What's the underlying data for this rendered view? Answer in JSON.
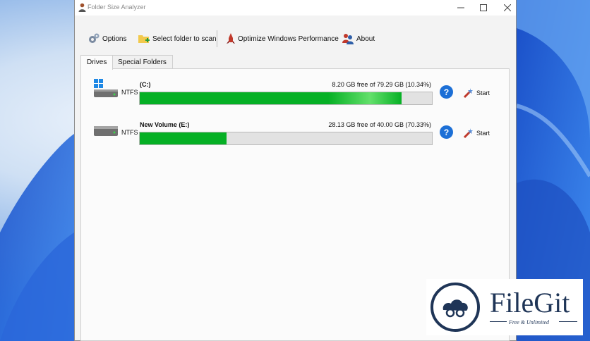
{
  "window": {
    "title": "Folder Size Analyzer",
    "controls": {
      "minimize": "—",
      "maximize": "☐",
      "close": "✕"
    }
  },
  "toolbar": {
    "options_label": "Options",
    "select_folder_label": "Select folder to scan",
    "optimize_label": "Optimize Windows Performance",
    "about_label": "About"
  },
  "tabs": [
    {
      "label": "Drives",
      "active": true
    },
    {
      "label": "Special Folders",
      "active": false
    }
  ],
  "drives": [
    {
      "filesystem": "NTFS",
      "name": "(C:)",
      "free_text": "8.20 GB free of 79.29 GB (10.34%)",
      "used_fraction": 0.8966,
      "help_label": "?",
      "start_label": "Start"
    },
    {
      "filesystem": "NTFS",
      "name": "New Volume (E:)",
      "free_text": "28.13 GB free of 40.00 GB (70.33%)",
      "used_fraction": 0.2967,
      "help_label": "?",
      "start_label": "Start"
    }
  ],
  "watermark": {
    "name": "FileGit",
    "tagline": "Free & Unlimited"
  },
  "colors": {
    "progress_fill": "#06b025",
    "progress_track": "#e2e2e2",
    "help_button": "#1c6fd6",
    "watermark_text": "#1f3557"
  }
}
